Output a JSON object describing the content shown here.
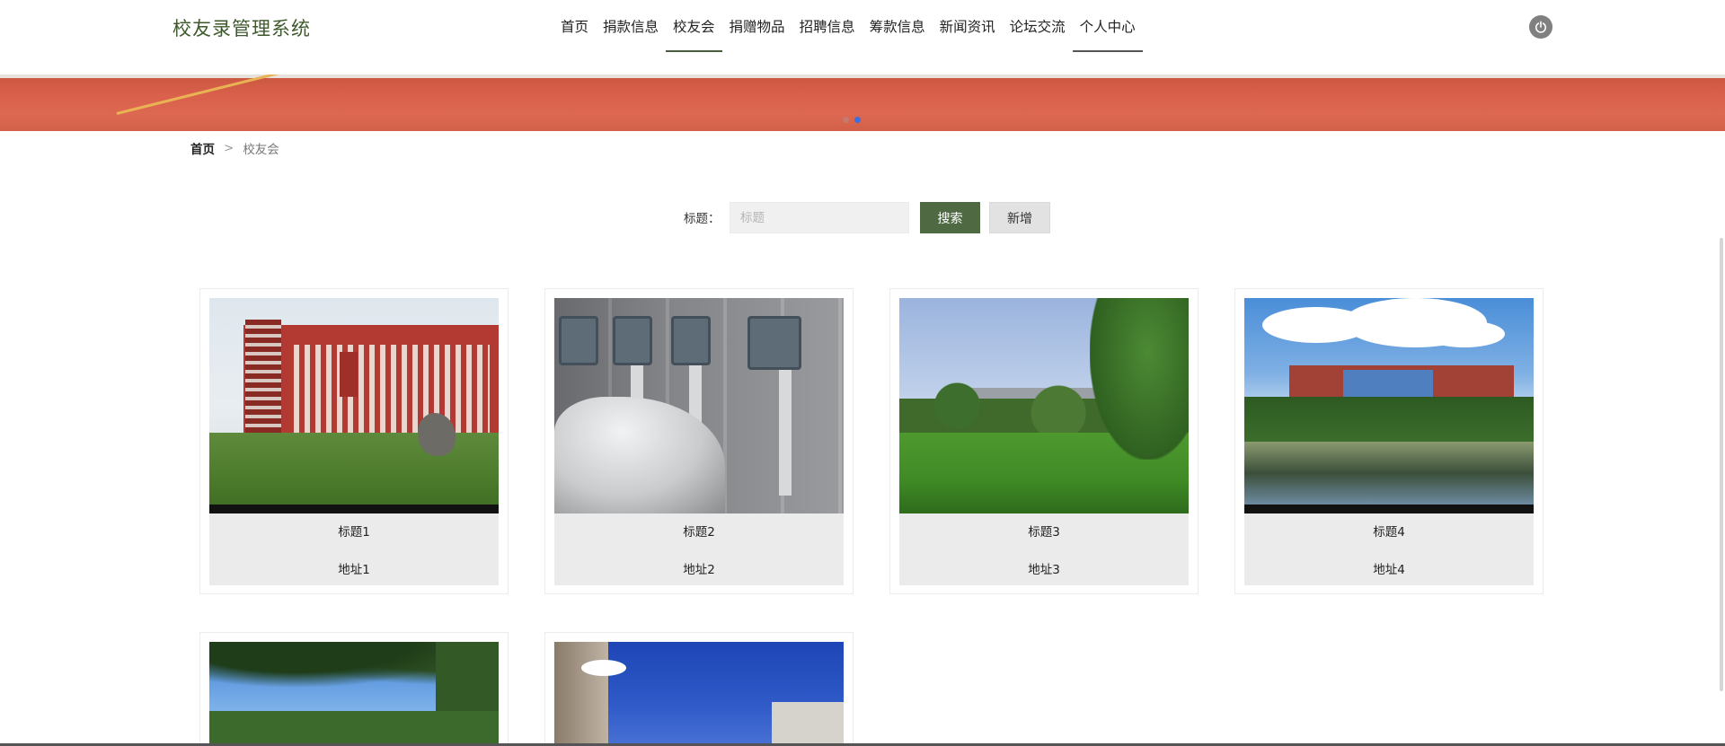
{
  "header": {
    "logo": "校友录管理系统",
    "nav": [
      {
        "label": "首页"
      },
      {
        "label": "捐款信息"
      },
      {
        "label": "校友会"
      },
      {
        "label": "捐赠物品"
      },
      {
        "label": "招聘信息"
      },
      {
        "label": "筹款信息"
      },
      {
        "label": "新闻资讯"
      },
      {
        "label": "论坛交流"
      },
      {
        "label": "个人中心"
      }
    ],
    "active_nav": "校友会"
  },
  "breadcrumb": {
    "home": "首页",
    "separator": ">",
    "current": "校友会"
  },
  "search": {
    "label": "标题：",
    "placeholder": "标题",
    "value": "",
    "search_button": "搜索",
    "add_button": "新增"
  },
  "cards": [
    {
      "title": "标题1",
      "address": "地址1"
    },
    {
      "title": "标题2",
      "address": "地址2"
    },
    {
      "title": "标题3",
      "address": "地址3"
    },
    {
      "title": "标题4",
      "address": "地址4"
    }
  ],
  "colors": {
    "accent": "#4f6a42",
    "logo": "#3e5a2c",
    "banner": "#d9604a"
  }
}
